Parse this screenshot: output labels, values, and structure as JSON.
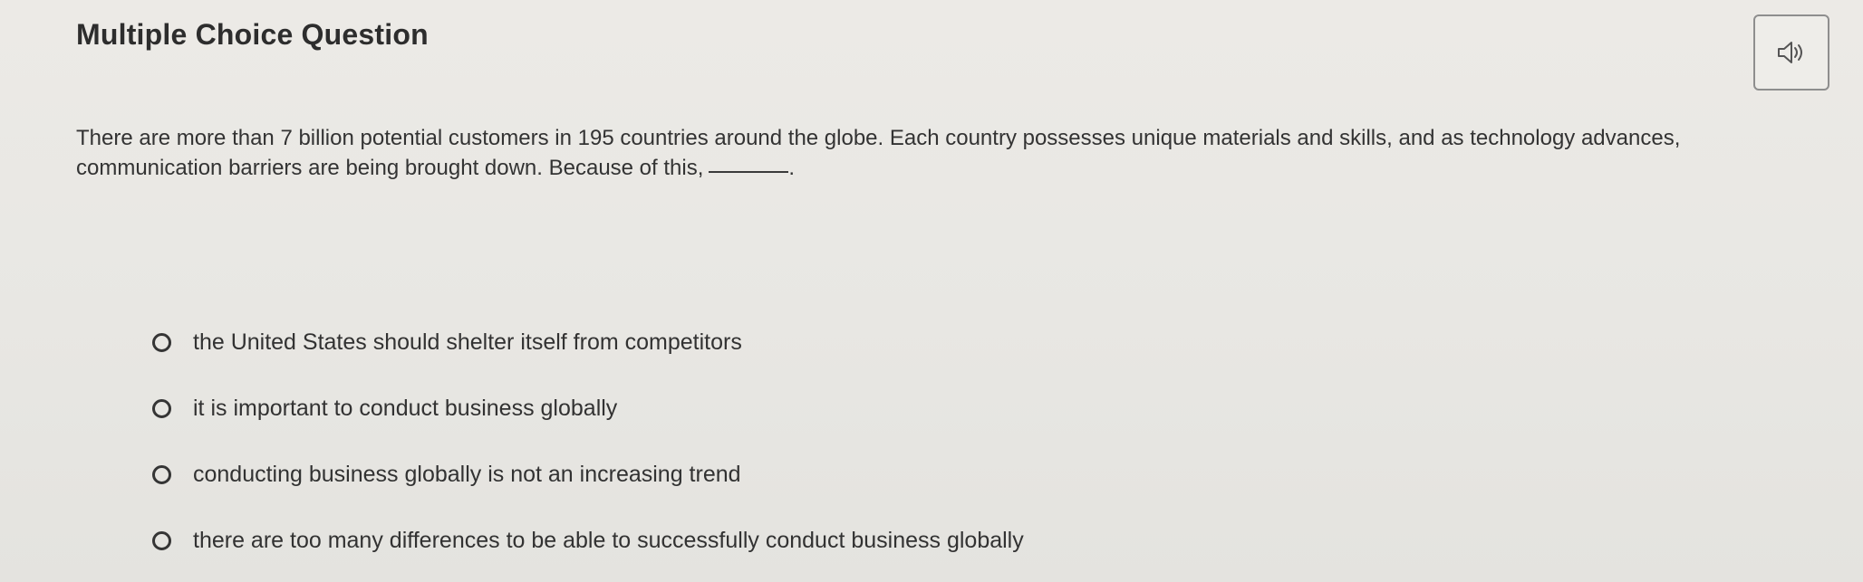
{
  "question": {
    "title": "Multiple Choice Question",
    "prompt_text": "There are more than 7 billion potential customers in 195 countries around the globe. Each country possesses unique materials and skills, and as technology advances, communication barriers are being brought down. Because of this,",
    "prompt_end": "."
  },
  "audio": {
    "icon": "speaker-icon"
  },
  "choices": [
    {
      "label": "the United States should shelter itself from competitors"
    },
    {
      "label": "it is important to conduct business globally"
    },
    {
      "label": "conducting business globally is not an increasing trend"
    },
    {
      "label": "there are too many differences to be able to successfully conduct business globally"
    }
  ]
}
